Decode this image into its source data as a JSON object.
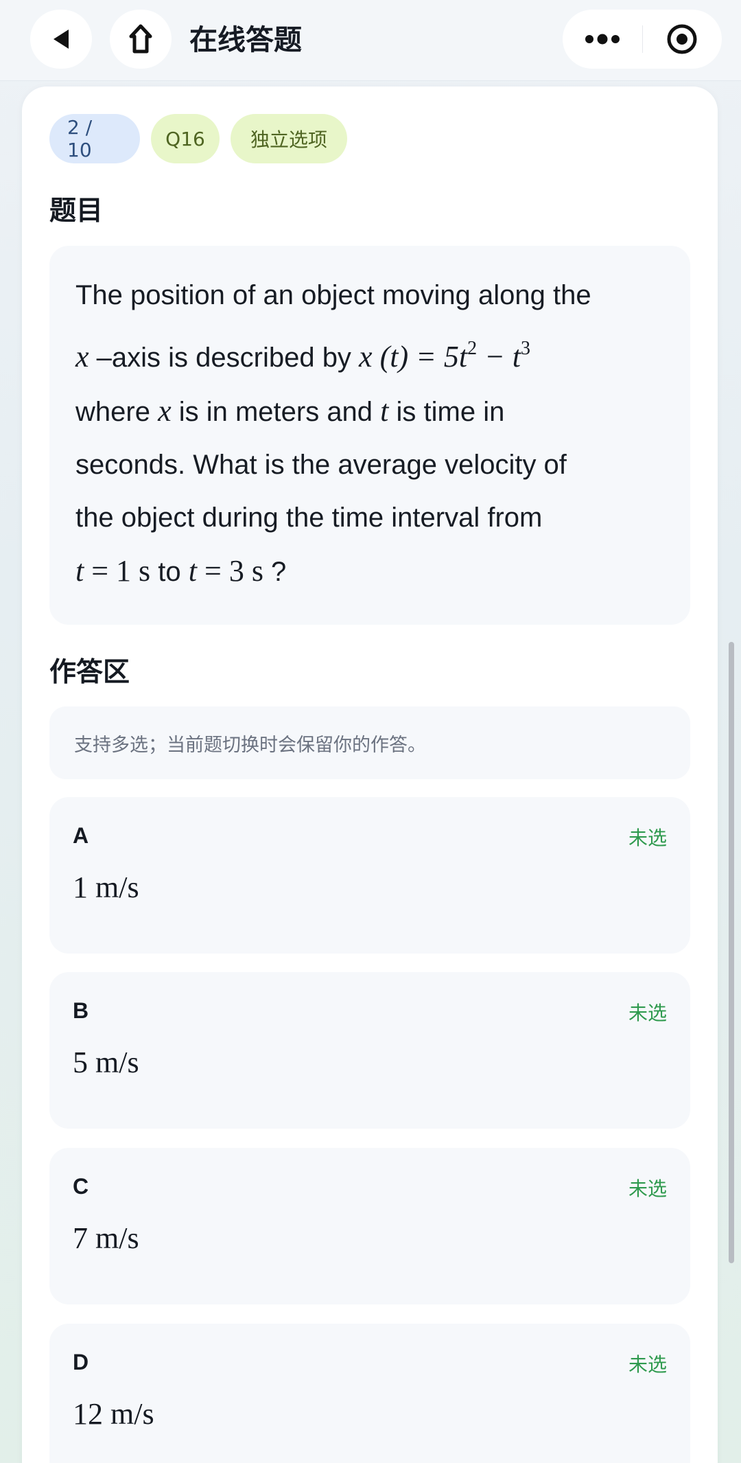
{
  "nav": {
    "title": "在线答题",
    "back_icon": "back-triangle-icon",
    "home_icon": "home-icon",
    "more_icon": "more-dots-icon",
    "target_icon": "target-icon"
  },
  "tags": {
    "progress": "2 / 10",
    "question_id": "Q16",
    "question_type": "独立选项"
  },
  "question": {
    "section_title": "题目",
    "parts": {
      "p1": "The position of an object moving along the",
      "x1": "x",
      "p2": " –axis is described by ",
      "x2": "x",
      "t1": "t",
      "eq1_mid": " = 5",
      "t2": "t",
      "sq": "2",
      "minus": " − ",
      "t3": "t",
      "cube": "3",
      "p3": "where ",
      "x3": "x",
      "p4": " is in meters and ",
      "t4": "t",
      "p5": " is time in",
      "p6": "seconds. What is the average velocity of",
      "p7": "the object during the time interval from",
      "t5": "t",
      "eq2": " = 1 s",
      "p8": " to ",
      "t6": "t",
      "eq3": " = 3 s",
      "p9": " ?"
    }
  },
  "answer": {
    "section_title": "作答区",
    "hint": "支持多选；当前题切换时会保留你的作答。",
    "options": [
      {
        "letter": "A",
        "status": "未选",
        "value": "1 m/s"
      },
      {
        "letter": "B",
        "status": "未选",
        "value": "5 m/s"
      },
      {
        "letter": "C",
        "status": "未选",
        "value": "7 m/s"
      },
      {
        "letter": "D",
        "status": "未选",
        "value": "12 m/s"
      }
    ]
  },
  "colors": {
    "accent_green": "#2f9a4e",
    "progress_tag_bg": "#dde9fb",
    "tag_bg": "#e8f6c9"
  }
}
